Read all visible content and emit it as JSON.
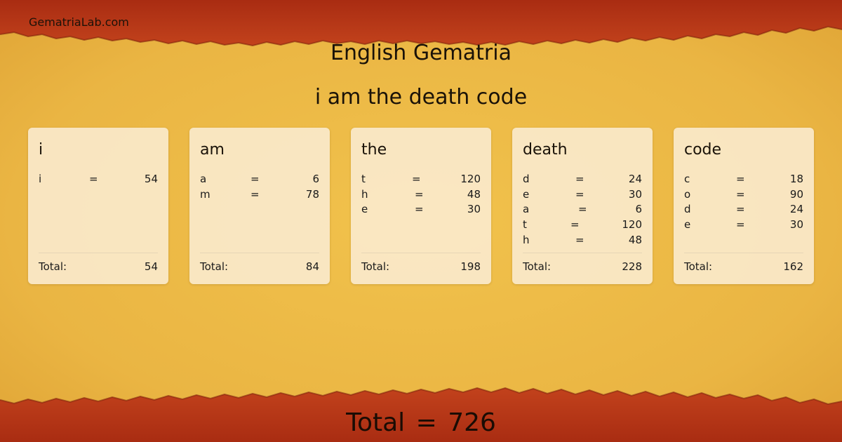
{
  "header": {
    "site_name": "GematriaLab.com",
    "title": "English Gematria",
    "phrase": "i am the death code"
  },
  "words": [
    {
      "word": "i",
      "letters": [
        {
          "letter": "i",
          "eq": "=",
          "value": "54"
        }
      ],
      "total_label": "Total:",
      "total": "54"
    },
    {
      "word": "am",
      "letters": [
        {
          "letter": "a",
          "eq": "=",
          "value": "6"
        },
        {
          "letter": "m",
          "eq": "=",
          "value": "78"
        }
      ],
      "total_label": "Total:",
      "total": "84"
    },
    {
      "word": "the",
      "letters": [
        {
          "letter": "t",
          "eq": "=",
          "value": "120"
        },
        {
          "letter": "h",
          "eq": "=",
          "value": "48"
        },
        {
          "letter": "e",
          "eq": "=",
          "value": "30"
        }
      ],
      "total_label": "Total:",
      "total": "198"
    },
    {
      "word": "death",
      "letters": [
        {
          "letter": "d",
          "eq": "=",
          "value": "24"
        },
        {
          "letter": "e",
          "eq": "=",
          "value": "30"
        },
        {
          "letter": "a",
          "eq": "=",
          "value": "6"
        },
        {
          "letter": "t",
          "eq": "=",
          "value": "120"
        },
        {
          "letter": "h",
          "eq": "=",
          "value": "48"
        }
      ],
      "total_label": "Total:",
      "total": "228"
    },
    {
      "word": "code",
      "letters": [
        {
          "letter": "c",
          "eq": "=",
          "value": "18"
        },
        {
          "letter": "o",
          "eq": "=",
          "value": "90"
        },
        {
          "letter": "d",
          "eq": "=",
          "value": "24"
        },
        {
          "letter": "e",
          "eq": "=",
          "value": "30"
        }
      ],
      "total_label": "Total:",
      "total": "162"
    }
  ],
  "footer": {
    "grand_total": "Total = 726"
  },
  "colors": {
    "parchment": "#e9b441",
    "border_red": "#b8361a",
    "card_bg": "#faecd2"
  }
}
